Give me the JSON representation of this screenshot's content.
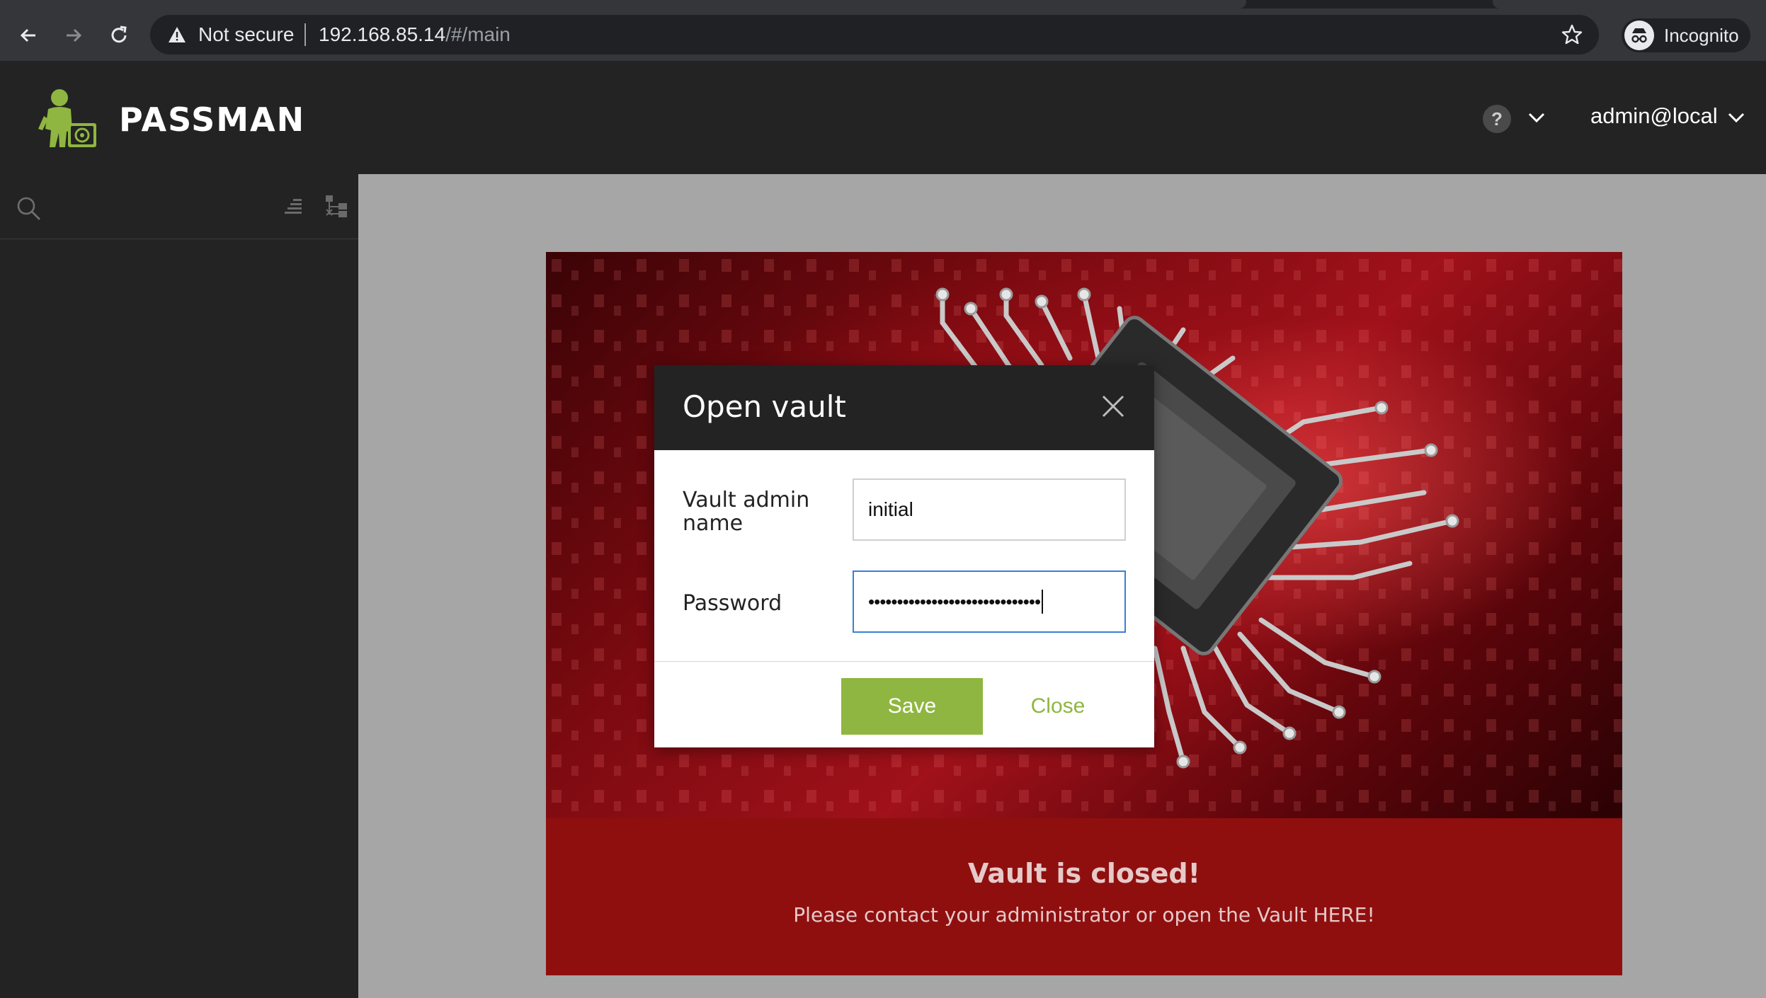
{
  "browser": {
    "security_label": "Not secure",
    "url_host": "192.168.85.14",
    "url_path": "/#/main",
    "profile_label": "Incognito"
  },
  "header": {
    "brand": "PASSMAN",
    "help_label": "?",
    "user": "admin@local"
  },
  "modal": {
    "title": "Open vault",
    "fields": [
      {
        "label_line1": "Vault admin",
        "label_line2": "name",
        "value": "initial"
      },
      {
        "label": "Password",
        "value": "••••••••••••••••••••••••••••••"
      }
    ],
    "save_label": "Save",
    "close_label": "Close"
  },
  "status": {
    "title": "Vault is closed!",
    "message": "Please contact your administrator or open the Vault HERE!"
  },
  "colors": {
    "accent_green": "#8fb640",
    "closed_red": "#8f0f0f",
    "header_dark": "#232323",
    "focus_blue": "#3b7fd1"
  }
}
